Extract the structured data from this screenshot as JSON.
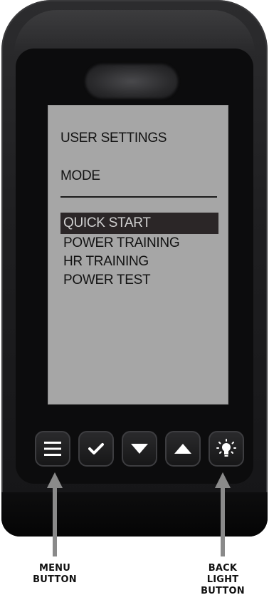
{
  "screen": {
    "title": "USER SETTINGS",
    "mode_label": "MODE",
    "menu_items": [
      {
        "label": "QUICK START",
        "selected": true
      },
      {
        "label": "POWER TRAINING",
        "selected": false
      },
      {
        "label": "HR TRAINING",
        "selected": false
      },
      {
        "label": "POWER TEST",
        "selected": false
      }
    ]
  },
  "buttons": [
    {
      "name": "menu",
      "icon": "hamburger-icon"
    },
    {
      "name": "confirm",
      "icon": "checkmark-icon"
    },
    {
      "name": "down",
      "icon": "triangle-down-icon"
    },
    {
      "name": "up",
      "icon": "triangle-up-icon"
    },
    {
      "name": "backlight",
      "icon": "lightbulb-icon"
    }
  ],
  "callouts": {
    "menu_button_line1": "MENU",
    "menu_button_line2": "BUTTON",
    "back_light_line1": "BACK",
    "back_light_line2": "LIGHT",
    "back_light_line3": "BUTTON"
  },
  "colors": {
    "device_body": "#1f1f21",
    "screen_bg": "#a6a6a6",
    "selected_bg": "#2b2627",
    "arrow": "#8a8a8a"
  }
}
